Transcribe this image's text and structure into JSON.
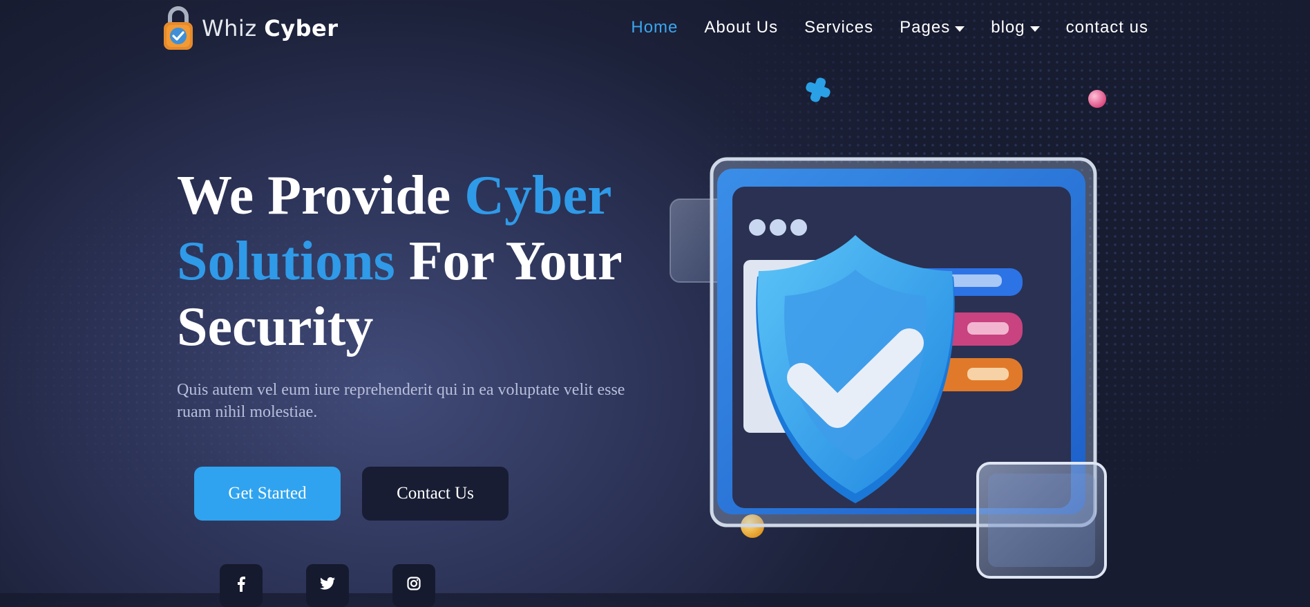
{
  "brand": {
    "name_light": "Whiz",
    "name_bold": "Cyber",
    "logo_icon": "padlock-shield-icon"
  },
  "nav": {
    "items": [
      {
        "label": "Home",
        "active": true,
        "dropdown": false
      },
      {
        "label": "About Us",
        "active": false,
        "dropdown": false
      },
      {
        "label": "Services",
        "active": false,
        "dropdown": false
      },
      {
        "label": "Pages",
        "active": false,
        "dropdown": true
      },
      {
        "label": "blog",
        "active": false,
        "dropdown": true
      },
      {
        "label": "contact us",
        "active": false,
        "dropdown": false
      }
    ]
  },
  "hero": {
    "title_part1": "We Provide ",
    "title_accent1": "Cyber",
    "title_accent2": "Solutions",
    "title_part2": " For Your",
    "title_part3": "Security",
    "subtitle": "Quis autem vel eum iure reprehenderit qui in ea voluptate velit esse ruam nihil molestiae.",
    "primary_button": "Get Started",
    "secondary_button": "Contact Us"
  },
  "social": [
    {
      "icon": "facebook-icon"
    },
    {
      "icon": "twitter-icon"
    },
    {
      "icon": "instagram-icon"
    }
  ],
  "colors": {
    "accent": "#2f9ae8",
    "primary_button": "#2fa3ef",
    "secondary_button": "#181d34",
    "background": "#1c2139"
  },
  "illustration": {
    "icon": "shield-checkmark-browser-illustration"
  }
}
